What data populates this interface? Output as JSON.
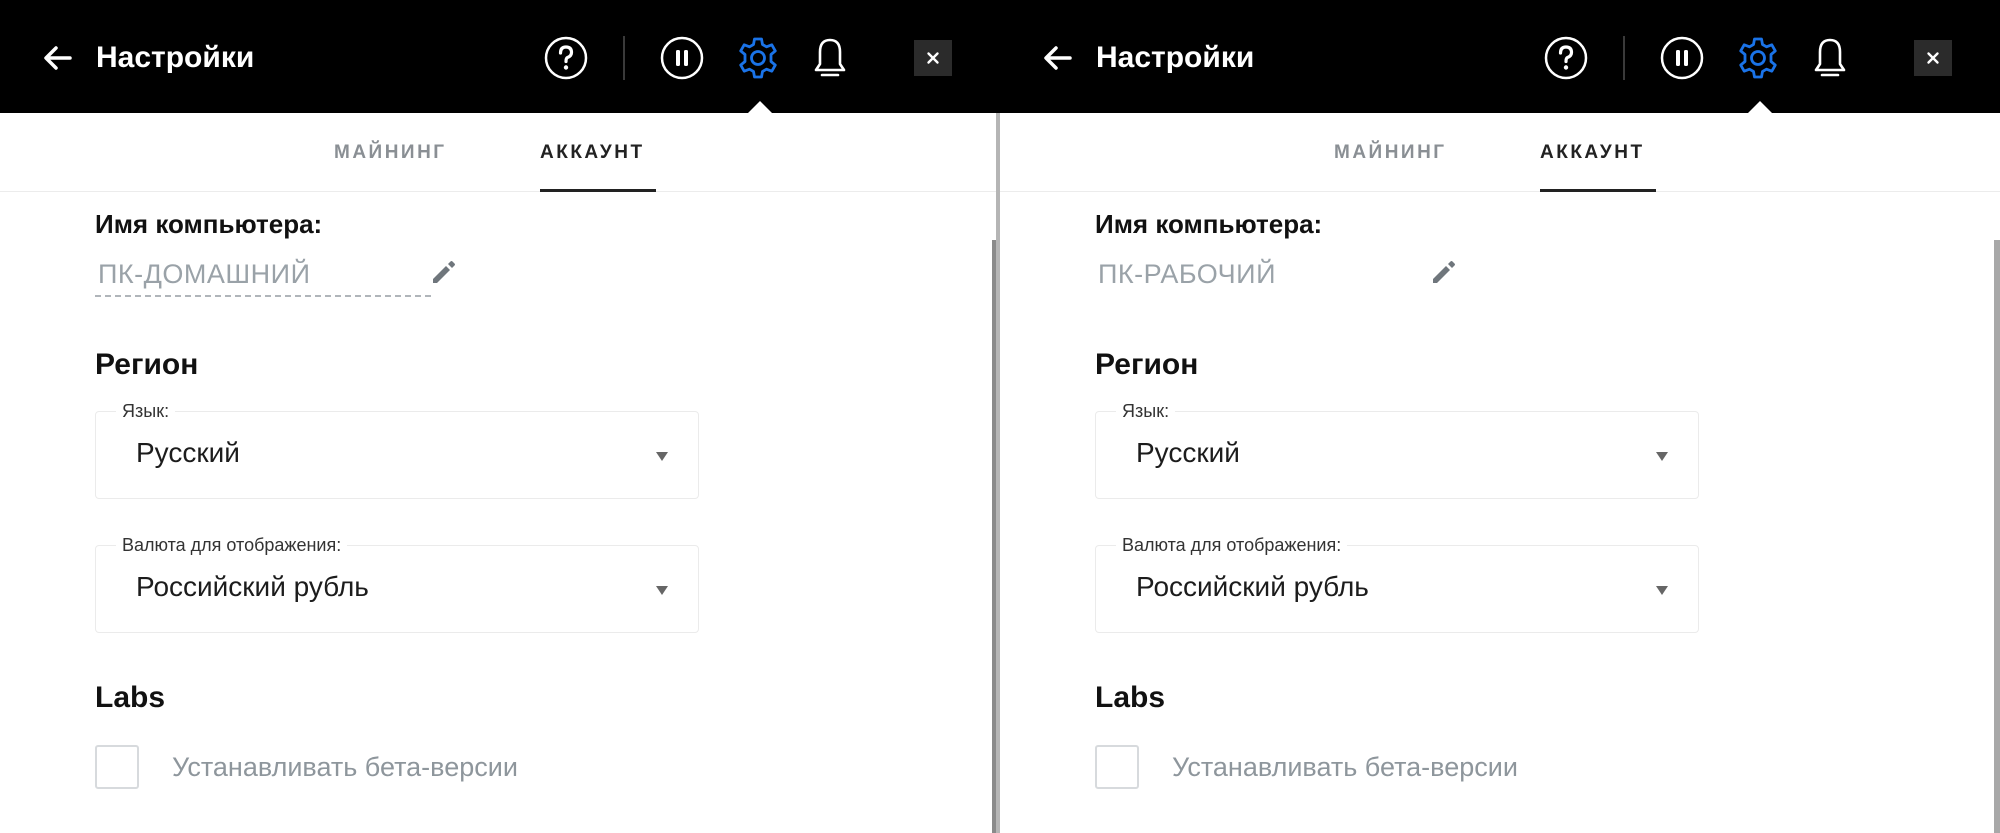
{
  "colors": {
    "header_bg": "#000000",
    "accent": "#1a73e8",
    "tab_active": "#222222",
    "tab_inactive": "#8a8f94",
    "muted_text": "#9aa2a8"
  },
  "panels": [
    {
      "header": {
        "title": "Настройки",
        "icons": [
          "back-arrow-icon",
          "help-icon",
          "pause-icon",
          "settings-gear-icon",
          "bell-icon",
          "close-icon"
        ],
        "close_label": "×"
      },
      "tabs": [
        {
          "label": "МАЙНИНГ",
          "active": false
        },
        {
          "label": "АККАУНТ",
          "active": true
        }
      ],
      "computer_name": {
        "label": "Имя компьютера:",
        "value": "ПК-ДОМАШНИЙ"
      },
      "region": {
        "title": "Регион",
        "language": {
          "label": "Язык:",
          "value": "Русский"
        },
        "currency": {
          "label": "Валюта для отображения:",
          "value": "Российский рубль"
        }
      },
      "labs": {
        "title": "Labs",
        "beta": {
          "label": "Устанавливать бета-версии",
          "checked": false
        }
      }
    },
    {
      "header": {
        "title": "Настройки",
        "icons": [
          "back-arrow-icon",
          "help-icon",
          "pause-icon",
          "settings-gear-icon",
          "bell-icon",
          "close-icon"
        ],
        "close_label": "×"
      },
      "tabs": [
        {
          "label": "МАЙНИНГ",
          "active": false
        },
        {
          "label": "АККАУНТ",
          "active": true
        }
      ],
      "computer_name": {
        "label": "Имя компьютера:",
        "value": "ПК-РАБОЧИЙ"
      },
      "region": {
        "title": "Регион",
        "language": {
          "label": "Язык:",
          "value": "Русский"
        },
        "currency": {
          "label": "Валюта для отображения:",
          "value": "Российский рубль"
        }
      },
      "labs": {
        "title": "Labs",
        "beta": {
          "label": "Устанавливать бета-версии",
          "checked": false
        }
      }
    }
  ]
}
